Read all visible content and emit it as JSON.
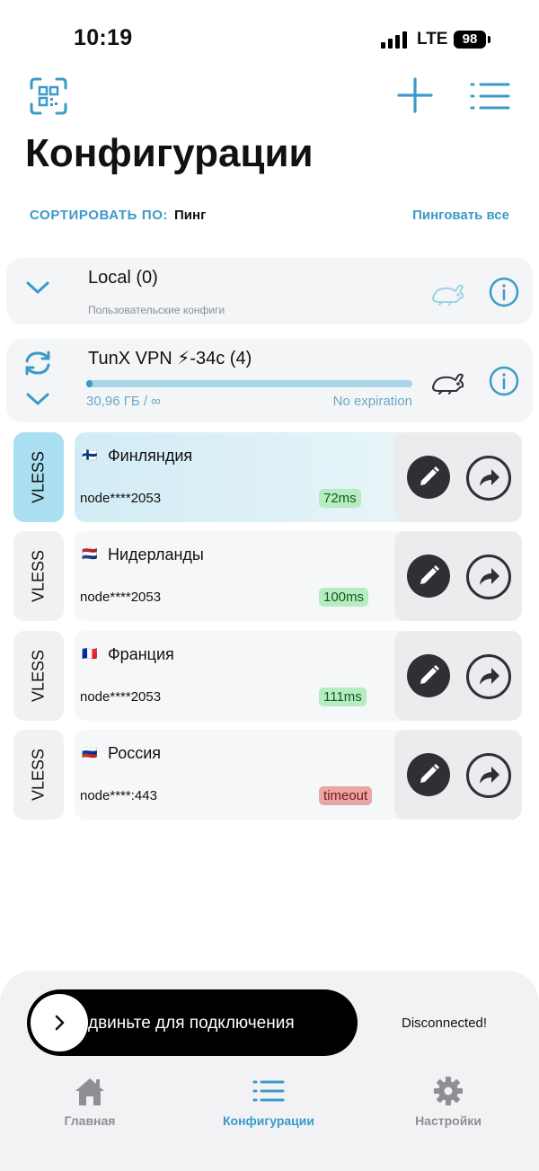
{
  "status_bar": {
    "time": "10:19",
    "network": "LTE",
    "battery": "98"
  },
  "header": {
    "title": "Конфигурации",
    "sort_label": "СОРТИРОВАТЬ ПО:",
    "sort_value": "Пинг",
    "ping_all": "Пинговать все"
  },
  "groups": [
    {
      "title": "Local (0)",
      "subtitle": "Пользовательские конфиги"
    },
    {
      "title": "TunX VPN ⚡-34с (4)",
      "usage": "30,96 ГБ / ∞",
      "expiry": "No expiration",
      "usage_fraction": 0.02
    }
  ],
  "nodes": [
    {
      "protocol": "VLESS",
      "flag": "🇫🇮",
      "name": "Финляндия",
      "host": "node****2053",
      "ping": "72ms",
      "ping_status": "ok",
      "active": true
    },
    {
      "protocol": "VLESS",
      "flag": "🇳🇱",
      "name": "Нидерланды",
      "host": "node****2053",
      "ping": "100ms",
      "ping_status": "ok",
      "active": false
    },
    {
      "protocol": "VLESS",
      "flag": "🇫🇷",
      "name": "Франция",
      "host": "node****2053",
      "ping": "111ms",
      "ping_status": "ok",
      "active": false
    },
    {
      "protocol": "VLESS",
      "flag": "🇷🇺",
      "name": "Россия",
      "host": "node****:443",
      "ping": "timeout",
      "ping_status": "bad",
      "active": false
    }
  ],
  "connect": {
    "slider_text": "двиньте для подключения",
    "status": "Disconnected!"
  },
  "tabs": [
    {
      "label": "Главная",
      "icon": "home-icon",
      "active": false
    },
    {
      "label": "Конфигурации",
      "icon": "list-icon",
      "active": true
    },
    {
      "label": "Настройки",
      "icon": "gear-icon",
      "active": false
    }
  ],
  "colors": {
    "accent": "#3b9ac9",
    "active_node": "#a9dff0",
    "inactive_tab": "#8e8e93"
  }
}
